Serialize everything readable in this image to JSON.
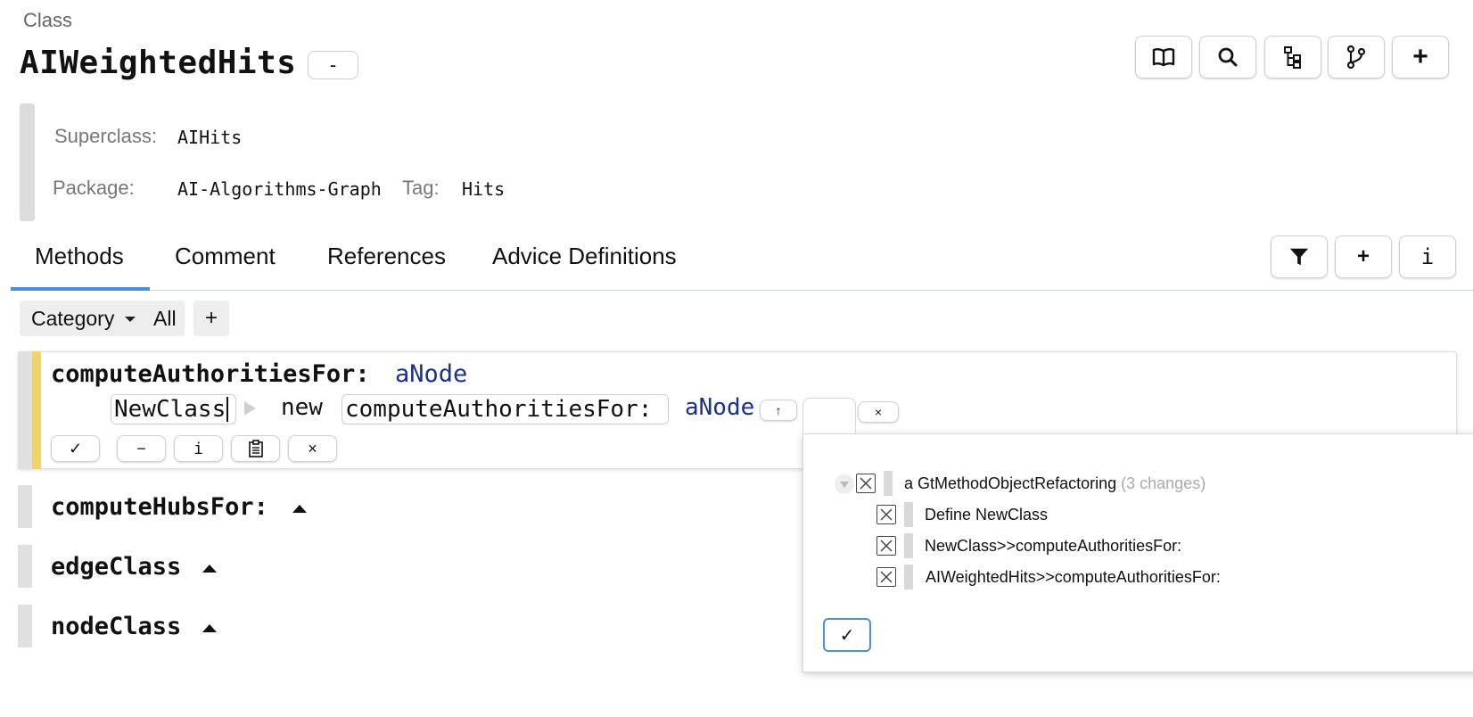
{
  "header": {
    "kind_label": "Class",
    "class_name": "AIWeightedHits",
    "collapse_label": "-"
  },
  "toolbar": {
    "icons": [
      "book-icon",
      "search-icon",
      "hierarchy-icon",
      "branch-icon",
      "plus-icon"
    ],
    "plus_label": "+"
  },
  "info": {
    "superclass_label": "Superclass:",
    "superclass_value": "AIHits",
    "package_label": "Package:",
    "package_value": "AI-Algorithms-Graph",
    "tag_label": "Tag:",
    "tag_value": "Hits"
  },
  "tabs": [
    {
      "label": "Methods",
      "active": true
    },
    {
      "label": "Comment",
      "active": false
    },
    {
      "label": "References",
      "active": false
    },
    {
      "label": "Advice Definitions",
      "active": false
    }
  ],
  "tab_actions": {
    "filter_icon": "filter-icon",
    "add_label": "+",
    "info_label": "i"
  },
  "filter": {
    "category_label": "Category",
    "all_label": "All",
    "add_label": "+"
  },
  "method_editor": {
    "selector": "computeAuthoritiesFor:",
    "argument": "aNode",
    "class_input": "NewClass",
    "new_keyword": "new",
    "selector_input": "computeAuthoritiesFor:",
    "argument2": "aNode",
    "up_label": "↑",
    "close_label": "×",
    "buttons": {
      "accept": "✓",
      "minus": "−",
      "inspect": "i",
      "clipboard_icon": "clipboard-icon",
      "cancel": "×"
    }
  },
  "collapsed_methods": [
    {
      "name": "computeHubsFor:"
    },
    {
      "name": "edgeClass"
    },
    {
      "name": "nodeClass"
    }
  ],
  "refactoring_popup": {
    "root_label": "a GtMethodObjectRefactoring",
    "root_count": "(3 changes)",
    "changes": [
      "Define NewClass",
      "NewClass>>computeAuthoritiesFor:",
      "AIWeightedHits>>computeAuthoritiesFor:"
    ],
    "apply_label": "✓"
  }
}
